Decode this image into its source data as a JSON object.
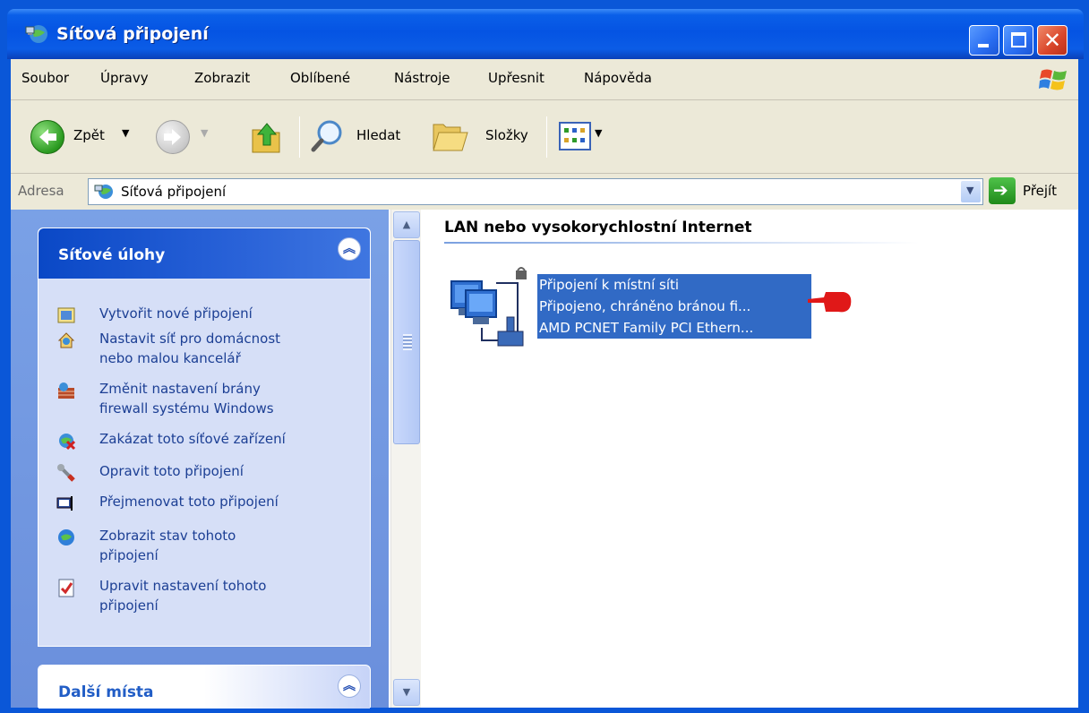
{
  "window": {
    "title": "Síťová připojení",
    "accent": "#0a57d8",
    "selection_color": "#316ac5",
    "title_icon": "network-globe-icon"
  },
  "menu": {
    "items": [
      "Soubor",
      "Úpravy",
      "Zobrazit",
      "Oblíbené",
      "Nástroje",
      "Upřesnit",
      "Nápověda"
    ]
  },
  "toolbar": {
    "back_label": "Zpět",
    "search_label": "Hledat",
    "folders_label": "Složky",
    "icons": [
      "back-arrow-icon",
      "forward-arrow-icon",
      "up-folder-icon",
      "search-magnifier-icon",
      "folders-icon",
      "views-icon"
    ]
  },
  "address": {
    "label": "Adresa",
    "value": "Síťová připojení",
    "go_label": "Přejít"
  },
  "tasks": {
    "header": "Síťové úlohy",
    "items": [
      {
        "label_line1": "Vytvořit nové připojení",
        "label_line2": "",
        "icon": "new-connection-icon"
      },
      {
        "label_line1": "Nastavit síť pro domácnost",
        "label_line2": "nebo malou kancelář",
        "icon": "home-network-icon"
      },
      {
        "label_line1": "Změnit nastavení brány",
        "label_line2": "firewall systému Windows",
        "icon": "firewall-icon"
      },
      {
        "label_line1": "Zakázat toto síťové zařízení",
        "label_line2": "",
        "icon": "disable-device-icon"
      },
      {
        "label_line1": "Opravit toto připojení",
        "label_line2": "",
        "icon": "repair-wrench-icon"
      },
      {
        "label_line1": "Přejmenovat toto připojení",
        "label_line2": "",
        "icon": "rename-icon"
      },
      {
        "label_line1": "Zobrazit stav tohoto",
        "label_line2": "připojení",
        "icon": "status-icon"
      },
      {
        "label_line1": "Upravit nastavení tohoto",
        "label_line2": "připojení",
        "icon": "properties-icon"
      }
    ]
  },
  "places": {
    "header": "Další místa"
  },
  "content": {
    "group_title": "LAN nebo vysokorychlostní Internet",
    "connection": {
      "name": "Připojení k místní síti",
      "status": "Připojeno, chráněno bránou fi...",
      "device": "AMD PCNET Family PCI Ethern..."
    }
  }
}
